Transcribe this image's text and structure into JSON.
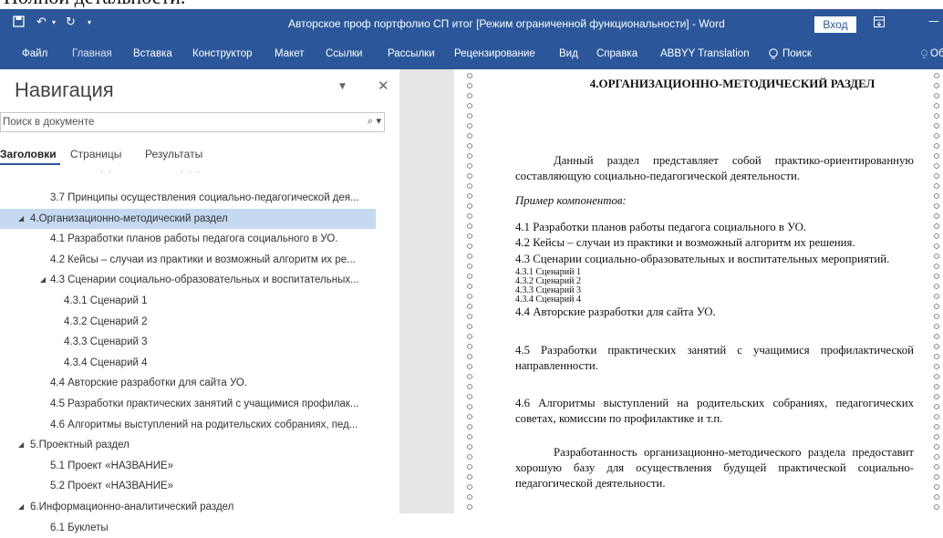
{
  "caption_fragment": "Полной детальности.",
  "titlebar": {
    "title": "Авторское проф портфолио СП итог [Режим ограниченной функциональности]  -  Word",
    "signin": "Вход"
  },
  "ribbon": {
    "tabs": [
      "Файл",
      "Главная",
      "Вставка",
      "Конструктор",
      "Макет",
      "Ссылки",
      "Рассылки",
      "Рецензирование",
      "Вид",
      "Справка",
      "ABBYY Translation",
      "Поиск"
    ],
    "share_label": "Об"
  },
  "navigation": {
    "title": "Навигация",
    "search_placeholder": "Поиск в документе",
    "tabs": [
      "Заголовки",
      "Страницы",
      "Результаты"
    ],
    "items": [
      {
        "label": "3.7 Принципы осуществления социально-педагогической дея...",
        "level": 2,
        "caret": false
      },
      {
        "label": "4.Организационно-методический раздел",
        "level": 1,
        "caret": true,
        "selected": true
      },
      {
        "label": "4.1 Разработки планов работы педагога социального в УО.",
        "level": 2,
        "caret": false
      },
      {
        "label": "4.2 Кейсы – случаи из практики и возможный алгоритм их ре...",
        "level": 2,
        "caret": false
      },
      {
        "label": "4.3 Сценарии социально-образовательных и воспитательных...",
        "level": 2,
        "caret": true
      },
      {
        "label": "4.3.1 Сценарий 1",
        "level": 3,
        "caret": false
      },
      {
        "label": "4.3.2 Сценарий 2",
        "level": 3,
        "caret": false
      },
      {
        "label": "4.3.3 Сценарий 3",
        "level": 3,
        "caret": false
      },
      {
        "label": "4.3.4 Сценарий 4",
        "level": 3,
        "caret": false
      },
      {
        "label": "4.4 Авторские разработки для сайта УО.",
        "level": 2,
        "caret": false
      },
      {
        "label": "4.5 Разработки практических занятий с учащимися профилак...",
        "level": 2,
        "caret": false
      },
      {
        "label": "4.6 Алгоритмы выступлений на родительских собраниях, пед...",
        "level": 2,
        "caret": false
      },
      {
        "label": "5.Проектный раздел",
        "level": 1,
        "caret": true
      },
      {
        "label": "5.1 Проект «НАЗВАНИЕ»",
        "level": 2,
        "caret": false
      },
      {
        "label": "5.2 Проект «НАЗВАНИЕ»",
        "level": 2,
        "caret": false
      },
      {
        "label": "6.Информационно-аналитический раздел",
        "level": 1,
        "caret": true
      },
      {
        "label": "6.1 Буклеты",
        "level": 2,
        "caret": false
      }
    ]
  },
  "document": {
    "heading": "4.ОРГАНИЗАЦИОННО-МЕТОДИЧЕСКИЙ РАЗДЕЛ",
    "intro": "Данный раздел представляет собой практико-ориентированную составляющую социально-педагогической деятельности.",
    "example_label": "Пример компонентов:",
    "line_41": "4.1 Разработки планов работы педагога социального в УО.",
    "line_42": "4.2 Кейсы – случаи из практики и возможный алгоритм их решения.",
    "line_43": "4.3 Сценарии социально-образовательных и воспитательных мероприятий.",
    "sub": [
      "4.3.1 Сценарий 1",
      "4.3.2 Сценарий 2",
      "4.3.3 Сценарий 3",
      "4.3.4 Сценарий 4"
    ],
    "line_44": "4.4 Авторские разработки для сайта УО.",
    "line_45": "4.5 Разработки практических занятий с учащимися профилактической направленности.",
    "line_46": "4.6 Алгоритмы выступлений на родительских собраниях, педагогических советах, комиссии по профилактике и т.п.",
    "closing": "Разработанность организационно-методического раздела предоставит хорошую базу для осуществления будущей практической социально-педагогической деятельности."
  },
  "colors": {
    "word_blue": "#2b579a",
    "selection": "#c5d9f1"
  }
}
